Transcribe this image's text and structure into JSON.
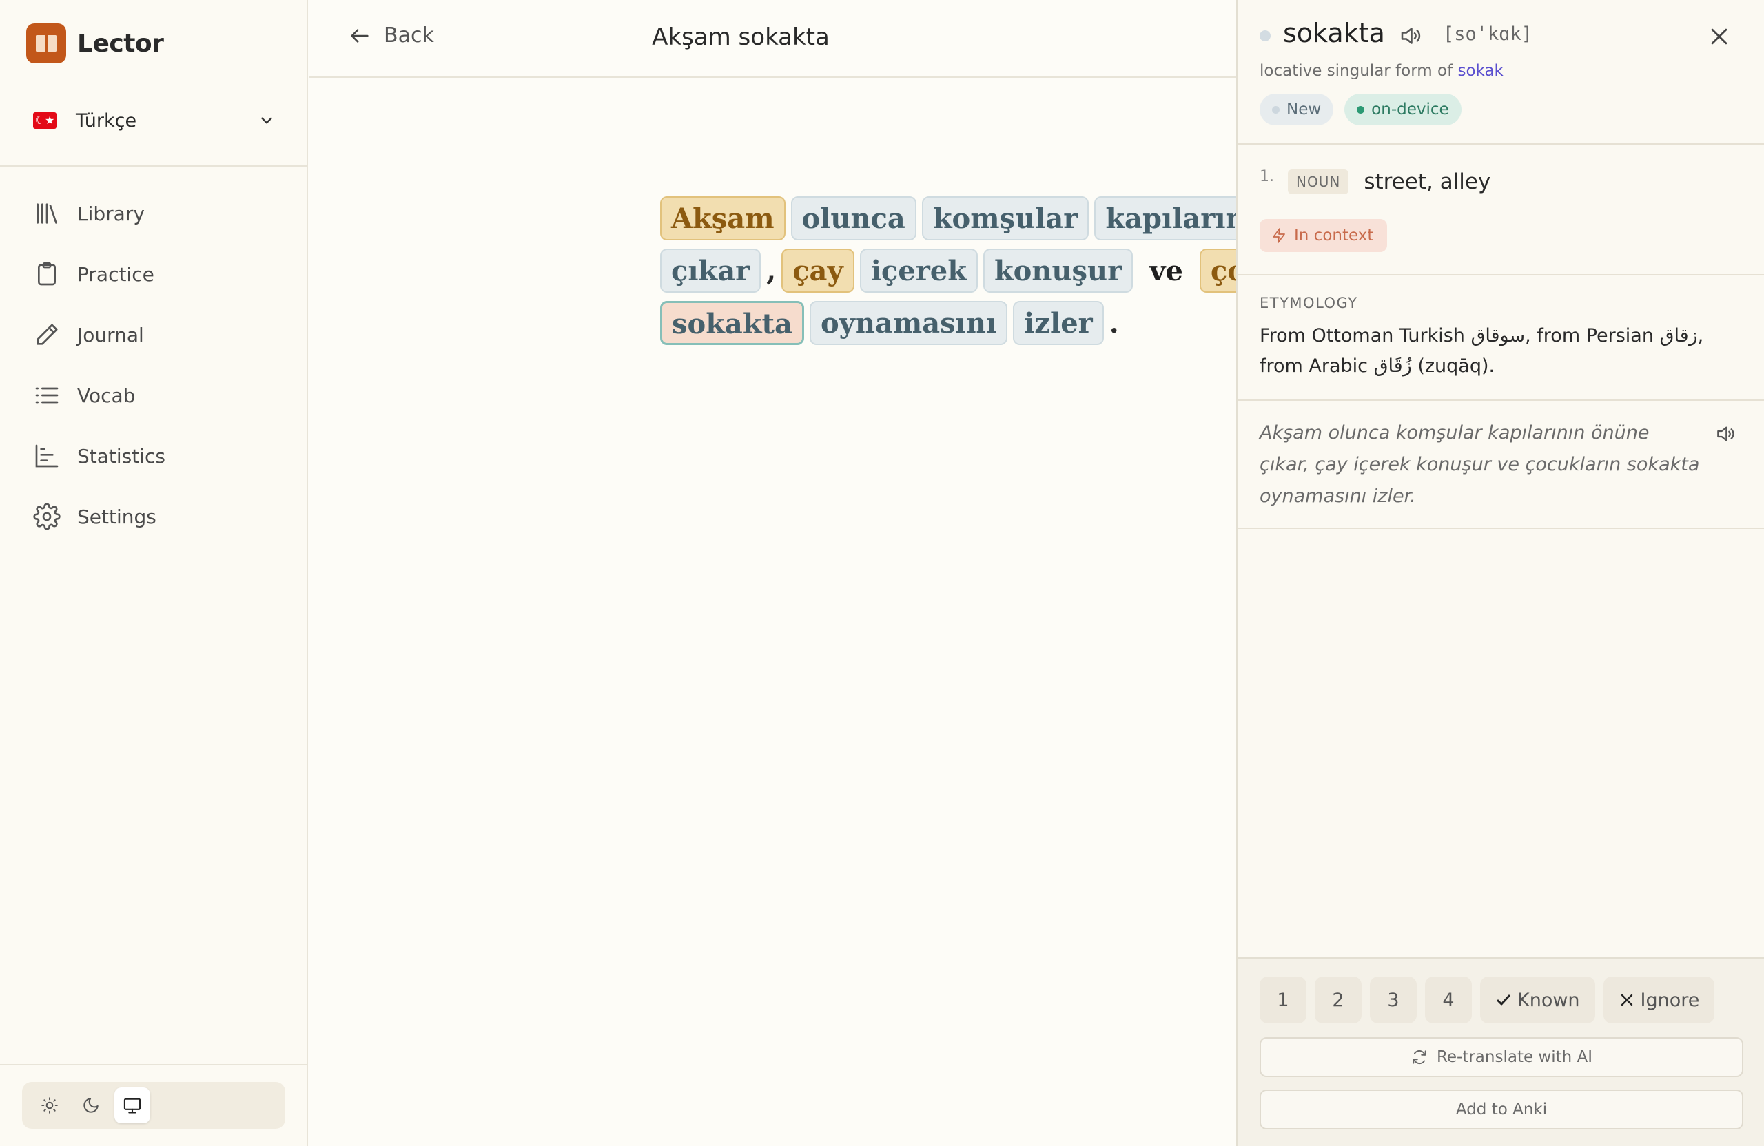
{
  "app": {
    "name": "Lector"
  },
  "language": {
    "name": "Türkçe",
    "flag": "☾★"
  },
  "nav": [
    {
      "label": "Library",
      "icon": "library-icon"
    },
    {
      "label": "Practice",
      "icon": "clipboard-icon"
    },
    {
      "label": "Journal",
      "icon": "pencil-icon"
    },
    {
      "label": "Vocab",
      "icon": "list-icon"
    },
    {
      "label": "Statistics",
      "icon": "chart-icon"
    },
    {
      "label": "Settings",
      "icon": "gear-icon"
    }
  ],
  "theme": {
    "active": "system"
  },
  "header": {
    "back_label": "Back",
    "title": "Akşam sokakta"
  },
  "reader": {
    "line1": [
      "Akşam",
      "olunca",
      "komşular",
      "kapılarının"
    ],
    "line2": [
      "çıkar",
      ",",
      "çay",
      "içerek",
      "konuşur",
      "ve",
      "çocu"
    ],
    "line3": [
      "sokakta",
      "oynamasını",
      "izler",
      "."
    ]
  },
  "panel": {
    "word": "sokakta",
    "ipa": "[soˈkɑk]",
    "subtitle_prefix": "locative singular form of ",
    "lemma": "sokak",
    "badge_new": "New",
    "badge_device": "on-device",
    "def_num": "1.",
    "pos": "NOUN",
    "gloss": "street, alley",
    "context_label": "In context",
    "etymology_heading": "ETYMOLOGY",
    "etymology": "From Ottoman Turkish سوقاق, from Persian زقاق, from Arabic زُقَاق (zuqāq).",
    "example": "Akşam olunca komşular kapılarının önüne çıkar, çay içerek konuşur ve çocukların sokakta oynamasını izler.",
    "ratings": [
      "1",
      "2",
      "3",
      "4"
    ],
    "known_label": "Known",
    "ignore_label": "Ignore",
    "retranslate_label": "Re-translate with AI",
    "anki_label": "Add to Anki"
  },
  "colors": {
    "accent": "#c2571a",
    "learning": "#f2deb0",
    "seen": "#e6ecee",
    "selected_border": "#86bfb8",
    "link": "#5a4fcf"
  }
}
